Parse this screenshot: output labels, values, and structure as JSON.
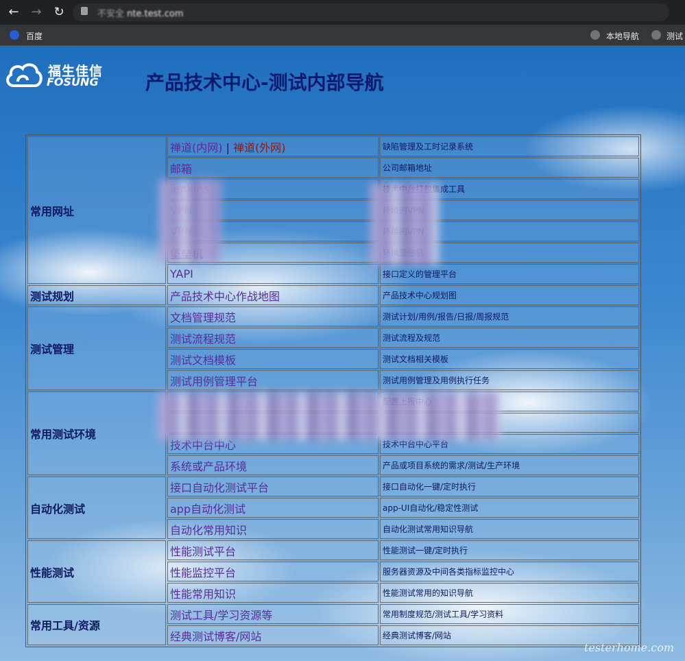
{
  "browser": {
    "url_security": "不安全",
    "url": "nte.test.com",
    "bookmarks": [
      {
        "label": "百度"
      },
      {
        "label": "本地导航"
      },
      {
        "label": "测试"
      }
    ]
  },
  "header": {
    "logo_cn": "福生佳信",
    "logo_en": "FOSUNG",
    "title": "产品技术中心-测试内部导航"
  },
  "table": {
    "groups": [
      {
        "category": "常用网址",
        "rows": [
          {
            "name": "禅道(内网)",
            "name2": "禅道(外网)",
            "desc": "缺陷管理及工时记录系统"
          },
          {
            "name": "邮箱",
            "desc": "公司邮箱地址"
          },
          {
            "name": "jenkins",
            "desc": "技术中台打包集成工具"
          },
          {
            "name": "VPN",
            "desc": "环境的VPN"
          },
          {
            "name": "VPN",
            "desc": "环境的VPN"
          },
          {
            "name": "堡垒机",
            "desc": "环境堡垒机"
          },
          {
            "name": "YAPI",
            "desc": "接口定义的管理平台"
          }
        ]
      },
      {
        "category": "测试规划",
        "rows": [
          {
            "name": "产品技术中心作战地图",
            "desc": "产品技术中心规划图"
          }
        ]
      },
      {
        "category": "测试管理",
        "rows": [
          {
            "name": "文档管理规范",
            "desc": "测试计划/用例/报告/日报/周报规范"
          },
          {
            "name": "测试流程规范",
            "desc": "测试流程及规范"
          },
          {
            "name": "测试文档模板",
            "desc": "测试文档相关模板"
          },
          {
            "name": "测试用例管理平台",
            "desc": "测试用例管理及用例执行任务"
          }
        ]
      },
      {
        "category": "常用测试环境",
        "rows": [
          {
            "name": "",
            "desc": "配置上报中心"
          },
          {
            "name": "",
            "desc": ""
          },
          {
            "name": "技术中台中心",
            "desc": "技术中台中心平台"
          },
          {
            "name": "系统或产品环境",
            "desc": "产品或项目系统的需求/测试/生产环境"
          }
        ]
      },
      {
        "category": "自动化测试",
        "rows": [
          {
            "name": "接口自动化测试平台",
            "desc": "接口自动化一键/定时执行"
          },
          {
            "name": "app自动化测试",
            "desc": "app-UI自动化/稳定性测试"
          },
          {
            "name": "自动化常用知识",
            "desc": "自动化测试常用知识导航"
          }
        ]
      },
      {
        "category": "性能测试",
        "rows": [
          {
            "name": "性能测试平台",
            "desc": "性能测试一键/定时执行"
          },
          {
            "name": "性能监控平台",
            "desc": "服务器资源及中间各类指标监控中心"
          },
          {
            "name": "性能常用知识",
            "desc": "性能测试常用的知识导航"
          }
        ]
      },
      {
        "category": "常用工具/资源",
        "rows": [
          {
            "name": "测试工具/学习资源等",
            "desc": "常用制度规范/测试工具/学习资料"
          },
          {
            "name": "经典测试博客/网站",
            "desc": "经典测试博客/网站"
          }
        ]
      }
    ]
  },
  "watermark": "testerhome.com",
  "colors": {
    "title": "#0c1a6e",
    "link": "#5a2b9a",
    "external_link": "#8a1a1a"
  }
}
